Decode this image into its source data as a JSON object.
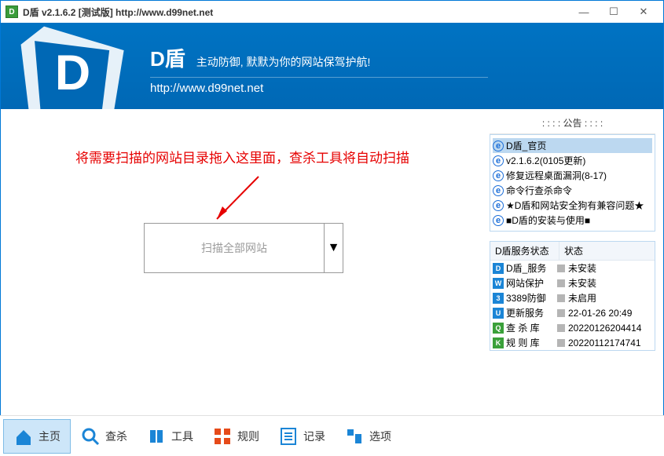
{
  "titlebar": {
    "appicon_glyph": "D",
    "title": "D盾 v2.1.6.2 [测试版] http://www.d99net.net"
  },
  "banner": {
    "title": "D盾",
    "slogan": "主动防御, 默默为你的网站保驾护航!",
    "url": "http://www.d99net.net"
  },
  "main": {
    "instruction": "将需要扫描的网站目录拖入这里面，查杀工具将自动扫描",
    "dropbox_text": "扫描全部网站",
    "dropbox_arrow": "▼"
  },
  "sidebar": {
    "notice_header": ": : : :   公告   : : : :",
    "notices": [
      {
        "text": "D盾_官页",
        "selected": true
      },
      {
        "text": "v2.1.6.2(0105更新)",
        "selected": false
      },
      {
        "text": "修复远程桌面漏洞(8-17)",
        "selected": false
      },
      {
        "text": "命令行查杀命令",
        "selected": false
      },
      {
        "text": "★D盾和网站安全狗有兼容问题★",
        "selected": false
      },
      {
        "text": "■D盾的安装与使用■",
        "selected": false
      }
    ],
    "status_header": {
      "col1": "D盾服务状态",
      "col2": "状态"
    },
    "services": [
      {
        "icon_color": "#1b85d6",
        "icon_glyph": "D",
        "name": "D盾_服务",
        "state": "未安装"
      },
      {
        "icon_color": "#1b85d6",
        "icon_glyph": "W",
        "name": "网站保护",
        "state": "未安装"
      },
      {
        "icon_color": "#1b85d6",
        "icon_glyph": "3",
        "name": "3389防御",
        "state": "未启用"
      },
      {
        "icon_color": "#1b85d6",
        "icon_glyph": "U",
        "name": "更新服务",
        "state": "22-01-26 20:49"
      },
      {
        "icon_color": "#3aa03a",
        "icon_glyph": "Q",
        "name": "查 杀 库",
        "state": "20220126204414"
      },
      {
        "icon_color": "#3aa03a",
        "icon_glyph": "K",
        "name": "规 则 库",
        "state": "20220112174741"
      }
    ]
  },
  "toolbar": {
    "items": [
      {
        "label": "主页",
        "icon": "home",
        "color": "#1b85d6",
        "active": true
      },
      {
        "label": "查杀",
        "icon": "search",
        "color": "#1b85d6",
        "active": false
      },
      {
        "label": "工具",
        "icon": "tools",
        "color": "#1b85d6",
        "active": false
      },
      {
        "label": "规则",
        "icon": "rules",
        "color": "#e64a19",
        "active": false
      },
      {
        "label": "记录",
        "icon": "list",
        "color": "#1b85d6",
        "active": false
      },
      {
        "label": "选项",
        "icon": "options",
        "color": "#1b85d6",
        "active": false
      }
    ]
  }
}
